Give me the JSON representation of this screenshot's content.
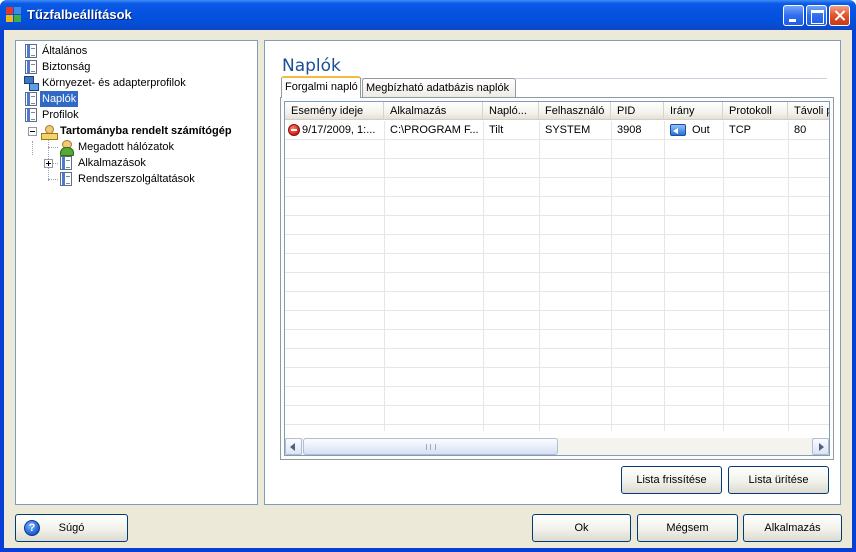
{
  "window": {
    "title": "Tűzfalbeállítások"
  },
  "tree": {
    "items": [
      {
        "label": "Általános"
      },
      {
        "label": "Biztonság"
      },
      {
        "label": "Környezet- és adapterprofilok"
      },
      {
        "label": "Naplók"
      },
      {
        "label": "Profilok"
      },
      {
        "label": "Tartományba rendelt számítógép"
      },
      {
        "label": "Megadott hálózatok"
      },
      {
        "label": "Alkalmazások"
      },
      {
        "label": "Rendszerszolgáltatások"
      }
    ],
    "selected": "Naplók"
  },
  "panel": {
    "title": "Naplók",
    "tabs": [
      {
        "label": "Forgalmi napló"
      },
      {
        "label": "Megbízható adatbázis  naplók"
      }
    ]
  },
  "table": {
    "columns": [
      "Esemény ideje",
      "Alkalmazás",
      "Napló...",
      "Felhasználó",
      "PID",
      "Irány",
      "Protokoll",
      "Távoli p"
    ],
    "rows": [
      {
        "time": "9/17/2009, 1:...",
        "app": "C:\\PROGRAM F...",
        "log": "Tilt",
        "user": "SYSTEM",
        "pid": "3908",
        "direction": "Out",
        "protocol": "TCP",
        "remote_port": "80",
        "status_icon": "block-icon",
        "direction_icon": "outbound-arrow-icon"
      }
    ],
    "scroll_thumb_glyph": "III"
  },
  "buttons": {
    "refresh": "Lista frissítése",
    "clear": "Lista ürítése",
    "help": "Súgó",
    "ok": "Ok",
    "cancel": "Mégsem",
    "apply": "Alkalmazás"
  },
  "colors": {
    "titlebar": "#0553e1",
    "selection": "#3169c6",
    "panel_title": "#1a4e96",
    "tab_highlight": "#f7b93e"
  }
}
